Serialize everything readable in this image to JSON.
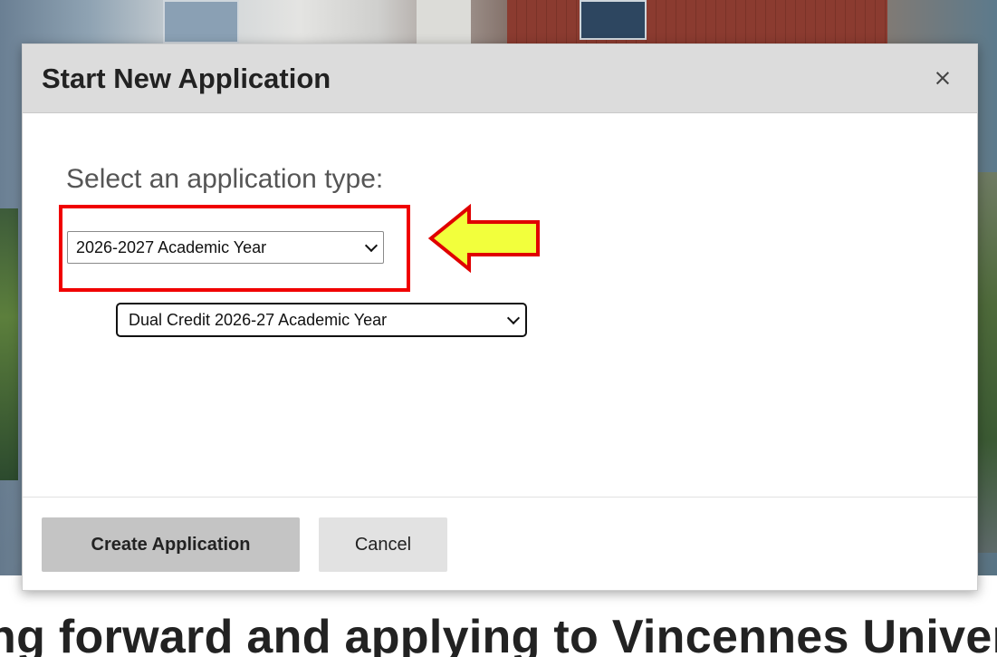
{
  "background": {
    "heading_text": "ng forward and applying to Vincennes Universi"
  },
  "modal": {
    "title": "Start New Application",
    "close_glyph": "×",
    "prompt": "Select an application type:",
    "primary_select": {
      "selected": "2026-2027 Academic Year"
    },
    "secondary_select": {
      "selected": "Dual Credit 2026-27 Academic Year"
    },
    "buttons": {
      "create_label": "Create Application",
      "cancel_label": "Cancel"
    }
  },
  "annotations": {
    "highlight_color": "#f00000",
    "arrow_fill": "#f2ff3c",
    "arrow_stroke": "#e00000"
  },
  "icons": {
    "close": "close-icon",
    "dropdown": "chevron-down-icon",
    "arrow": "left-arrow-icon"
  }
}
